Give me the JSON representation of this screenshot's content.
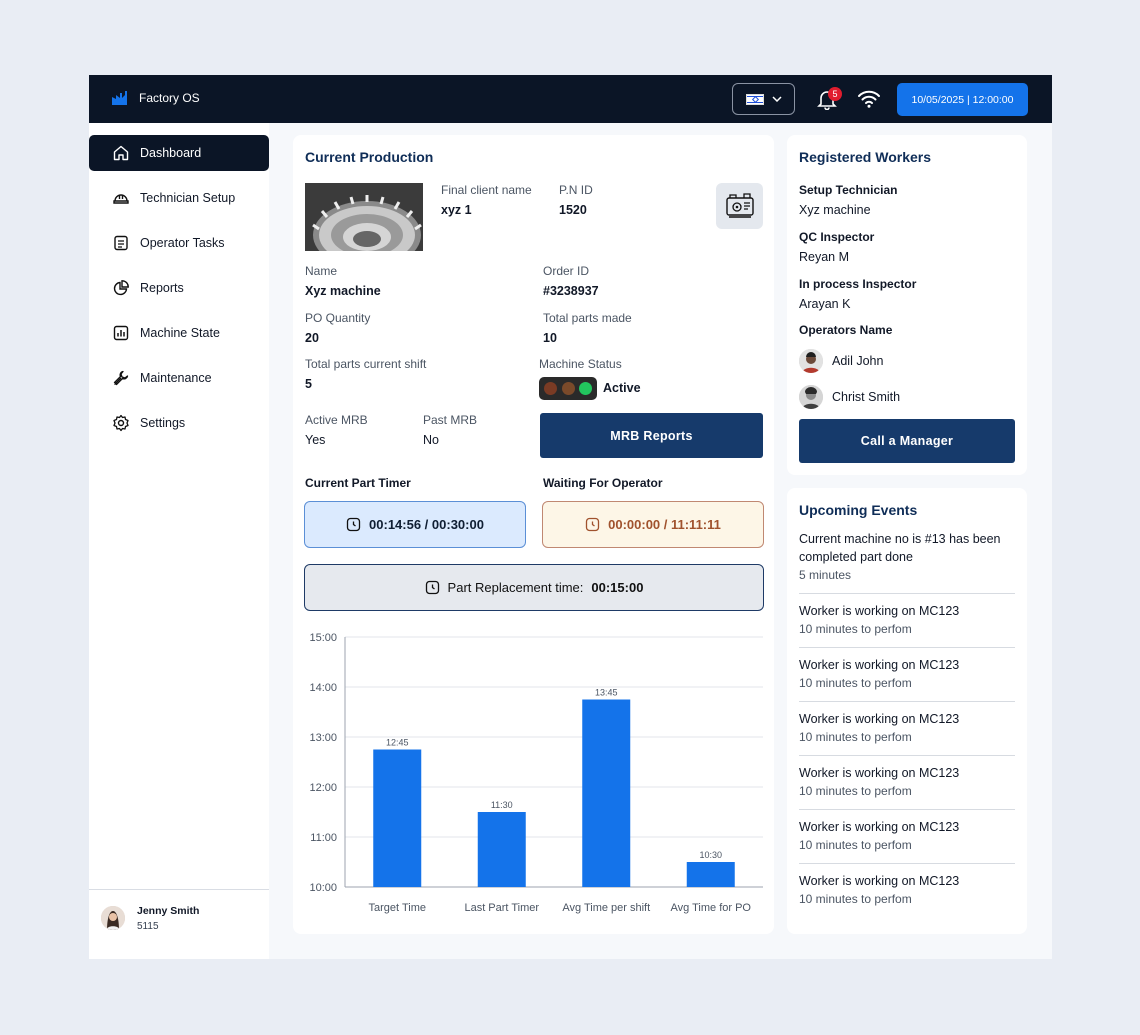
{
  "app": {
    "name": "Factory OS",
    "datetime": "10/05/2025 | 12:00:00",
    "notification_count": "5"
  },
  "sidebar": {
    "items": [
      {
        "label": "Dashboard",
        "icon": "home-icon",
        "active": true
      },
      {
        "label": "Technician Setup",
        "icon": "hardhat-icon"
      },
      {
        "label": "Operator Tasks",
        "icon": "tasks-icon"
      },
      {
        "label": "Reports",
        "icon": "pie-chart-icon"
      },
      {
        "label": "Machine State",
        "icon": "bar-chart-icon"
      },
      {
        "label": "Maintenance",
        "icon": "wrench-icon"
      },
      {
        "label": "Settings",
        "icon": "gear-icon"
      }
    ],
    "user": {
      "name": "Jenny Smith",
      "id": "5115"
    }
  },
  "production": {
    "title": "Current Production",
    "final_client_label": "Final client name",
    "final_client_value": "xyz 1",
    "pn_label": "P.N ID",
    "pn_value": "1520",
    "name_label": "Name",
    "name_value": "Xyz machine",
    "order_label": "Order ID",
    "order_value": "#3238937",
    "po_qty_label": "PO Quantity",
    "po_qty_value": "20",
    "total_made_label": "Total parts made",
    "total_made_value": "10",
    "shift_label": "Total parts current shift",
    "shift_value": "5",
    "machine_status_label": "Machine Status",
    "machine_status_value": "Active",
    "active_mrb_label": "Active MRB",
    "active_mrb_value": "Yes",
    "past_mrb_label": "Past MRB",
    "past_mrb_value": "No",
    "mrb_button": "MRB Reports",
    "part_timer_label": "Current Part Timer",
    "part_timer_value": "00:14:56 / 00:30:00",
    "waiting_label": "Waiting For Operator",
    "waiting_value": "00:00:00 / 11:11:11",
    "replacement_label": "Part Replacement time:",
    "replacement_value": "00:15:00"
  },
  "chart_data": {
    "type": "bar",
    "categories": [
      "Target Time",
      "Last Part Timer",
      "Avg Time per shift",
      "Avg Time for PO"
    ],
    "values": [
      12.75,
      11.5,
      13.75,
      10.5
    ],
    "data_labels": [
      "12:45",
      "11:30",
      "13:45",
      "10:30"
    ],
    "y_ticks": [
      "10:00",
      "11:00",
      "12:00",
      "13:00",
      "14:00",
      "15:00"
    ],
    "ylim": [
      10,
      15
    ],
    "grid": true,
    "bar_color": "#1473ea"
  },
  "workers": {
    "title": "Registered Workers",
    "setup_label": "Setup Technician",
    "setup_value": "Xyz machine",
    "qc_label": "QC Inspector",
    "qc_value": "Reyan M",
    "inprocess_label": "In process Inspector",
    "inprocess_value": "Arayan K",
    "operators_label": "Operators Name",
    "operators": [
      "Adil John",
      "Christ Smith"
    ],
    "call_button": "Call a Manager"
  },
  "events": {
    "title": "Upcoming Events",
    "items": [
      {
        "title": "Current machine no is #13 has been completed part done",
        "time": "5 minutes"
      },
      {
        "title": "Worker is working on MC123",
        "time": "10 minutes to perfom"
      },
      {
        "title": "Worker is working on MC123",
        "time": "10 minutes to perfom"
      },
      {
        "title": "Worker is working on MC123",
        "time": "10 minutes to perfom"
      },
      {
        "title": "Worker is working on MC123",
        "time": "10 minutes to perfom"
      },
      {
        "title": "Worker is working on MC123",
        "time": "10 minutes to perfom"
      },
      {
        "title": "Worker is working on MC123",
        "time": "10 minutes to perfom"
      }
    ]
  }
}
